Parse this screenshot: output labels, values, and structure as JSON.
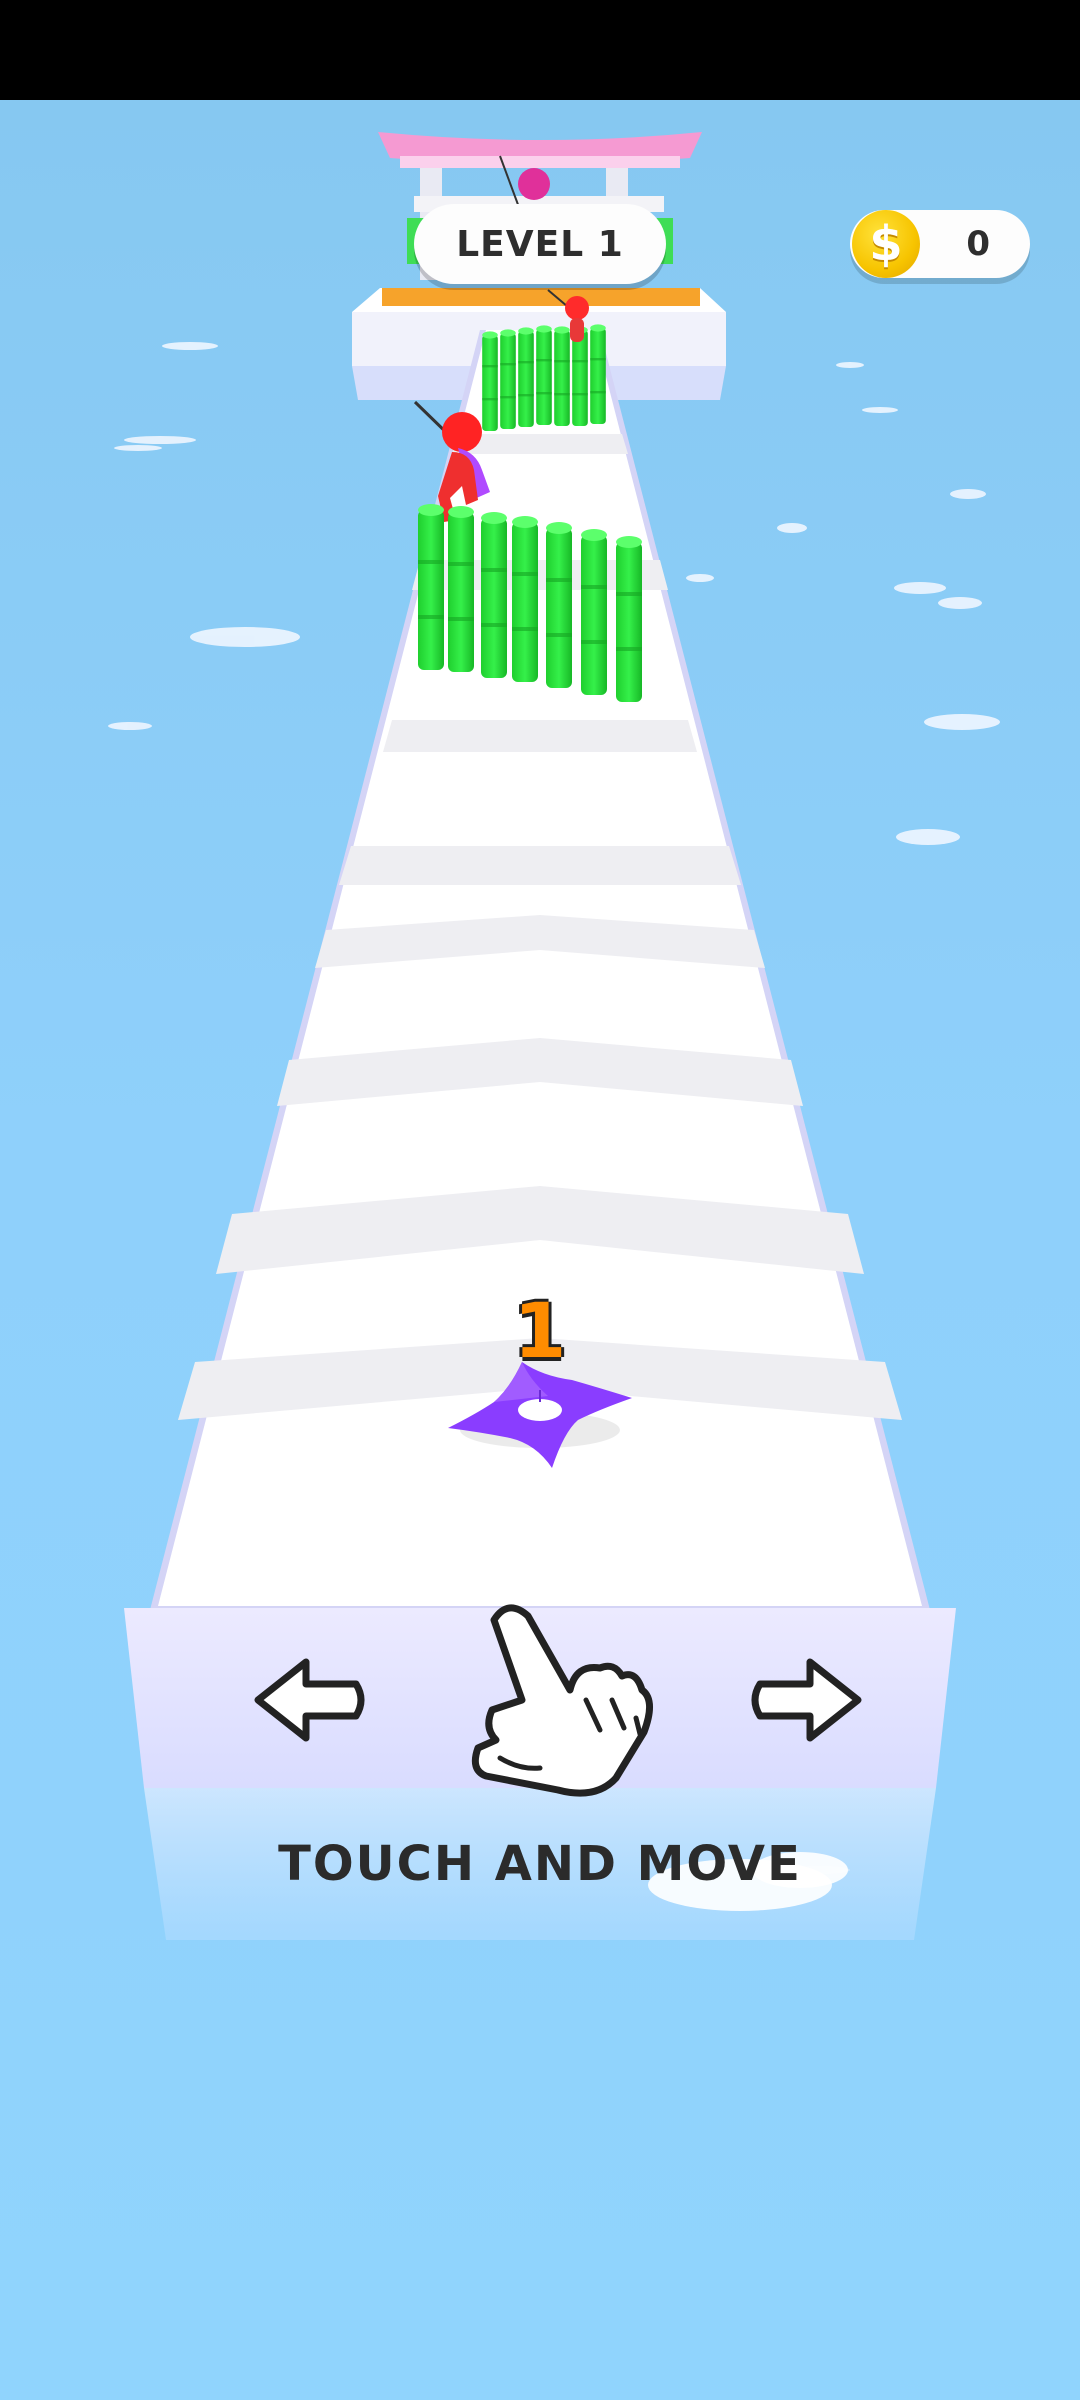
{
  "hud": {
    "level_label": "LEVEL 1",
    "coin_symbol": "$",
    "coin_count": "0",
    "coin_color": "#f7c400"
  },
  "player": {
    "stack_count": "1",
    "shuriken_color": "#8a3dff"
  },
  "tutorial": {
    "hint_text": "TOUCH AND MOVE",
    "left_icon": "arrow-left-icon",
    "right_icon": "arrow-right-icon",
    "hand_icon": "pointing-hand-icon"
  },
  "scene": {
    "water_color": "#8fd0fb",
    "track_color": "#f6f7fb",
    "obstacle_color": "#27e33a",
    "enemy_color": "#ff2b2b",
    "gate_color": "#f59ad2"
  }
}
